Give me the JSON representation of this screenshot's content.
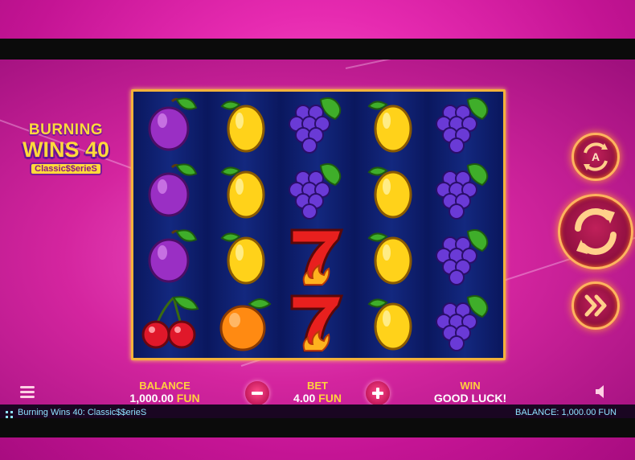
{
  "logo": {
    "line1": "BURNING",
    "line2": "WINS 40",
    "line3": "Classic$$erieS"
  },
  "reels": [
    [
      "plum-icon",
      "plum-icon",
      "plum-icon",
      "cherries-icon"
    ],
    [
      "lemon-icon",
      "lemon-icon",
      "lemon-icon",
      "orange-icon"
    ],
    [
      "grapes-icon",
      "grapes-icon",
      "seven-icon",
      "seven-icon"
    ],
    [
      "lemon-icon",
      "lemon-icon",
      "lemon-icon",
      "lemon-icon"
    ],
    [
      "grapes-icon",
      "grapes-icon",
      "grapes-icon",
      "grapes-icon"
    ]
  ],
  "controls": {
    "autoplay_icon": "autoplay-icon",
    "spin_icon": "spin-icon",
    "turbo_icon": "fast-forward-icon",
    "accent": "#ffb45e"
  },
  "hud": {
    "balance_label": "BALANCE",
    "balance_value": "1,000.00",
    "balance_unit": "FUN",
    "bet_label": "BET",
    "bet_value": "4.00",
    "bet_unit": "FUN",
    "win_label": "WIN",
    "win_value": "GOOD LUCK!"
  },
  "info": {
    "game_title": "Burning Wins 40: Classic$$erieS",
    "balance_text": "BALANCE: 1,000.00 FUN"
  },
  "colors": {
    "reel_frame": "#f3b23a",
    "label_gold": "#ffd13d",
    "info_text": "#8ee3ff"
  }
}
